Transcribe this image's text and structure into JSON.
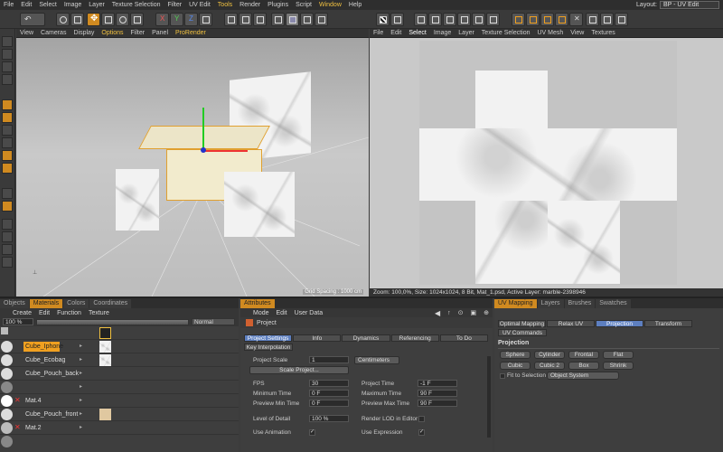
{
  "menubar": {
    "items": [
      "File",
      "Edit",
      "Select",
      "Image",
      "Layer",
      "Texture Selection",
      "Filter",
      "UV Edit",
      "Tools",
      "Render",
      "Plugins",
      "Script",
      "Window",
      "Help"
    ],
    "highlighted": [
      "Tools",
      "Window"
    ],
    "layout_label": "Layout:",
    "layout_value": "BP - UV Edit"
  },
  "viewport3d": {
    "menu": [
      "View",
      "Cameras",
      "Display",
      "Options",
      "Filter",
      "Panel",
      "ProRender"
    ],
    "highlighted": [
      "Options",
      "ProRender"
    ],
    "grid_spacing": "Grid Spacing : 1000 cm"
  },
  "uvview": {
    "menu": [
      "File",
      "Edit",
      "Select",
      "Image",
      "Layer",
      "Texture Selection",
      "UV Mesh",
      "View",
      "Textures"
    ],
    "highlighted": [
      "Select"
    ],
    "status": "Zoom: 100,0%, Size: 1024x1024, 8 Bit, Mat_1.psd, Active Layer: marble-2398946"
  },
  "materials": {
    "tabs": [
      "Objects",
      "Materials",
      "Colors",
      "Coordinates"
    ],
    "active_tab": "Materials",
    "menu": [
      "Create",
      "Edit",
      "Function",
      "Texture"
    ],
    "zoom": "100 %",
    "blend": "Normal",
    "rows": [
      {
        "name": "",
        "selected": false
      },
      {
        "name": "Cube_Iphone",
        "selected": true
      },
      {
        "name": "Cube_Ecobag",
        "selected": false
      },
      {
        "name": "Cube_Pouch_back",
        "selected": false
      },
      {
        "name": "",
        "selected": false
      },
      {
        "name": "Mat.4",
        "selected": false
      },
      {
        "name": "Cube_Pouch_front",
        "selected": false
      },
      {
        "name": "Mat.2",
        "selected": false
      }
    ]
  },
  "attributes": {
    "tab": "Attributes",
    "menu": [
      "Mode",
      "Edit",
      "User Data"
    ],
    "title": "Project",
    "tabs": [
      "Project Settings",
      "Info",
      "Dynamics",
      "Referencing",
      "To Do"
    ],
    "active_tab": "Project Settings",
    "subtab": "Key Interpolation",
    "project_scale_label": "Project Scale",
    "project_scale_value": "1",
    "project_scale_unit": "Centimeters",
    "scale_project_btn": "Scale Project...",
    "fps_label": "FPS",
    "fps_value": "30",
    "project_time_label": "Project Time",
    "project_time_value": "-1 F",
    "min_time_label": "Minimum Time",
    "min_time_value": "0 F",
    "max_time_label": "Maximum Time",
    "max_time_value": "90 F",
    "preview_min_label": "Preview Min Time",
    "preview_min_value": "0 F",
    "preview_max_label": "Preview Max Time",
    "preview_max_value": "90 F",
    "lod_label": "Level of Detail",
    "lod_value": "100 %",
    "render_lod_label": "Render LOD in Editor",
    "use_anim_label": "Use Animation",
    "use_expr_label": "Use Expression"
  },
  "uvpanel": {
    "tabs": [
      "UV Mapping",
      "Layers",
      "Brushes",
      "Swatches"
    ],
    "active_tab": "UV Mapping",
    "subtabs": [
      "Optimal Mapping",
      "Relax UV",
      "Projection",
      "Transform"
    ],
    "active_subtab": "Projection",
    "subtab2": "UV Commands",
    "section": "Projection",
    "buttons_row1": [
      "Sphere",
      "Cylinder",
      "Frontal",
      "Flat"
    ],
    "buttons_row2": [
      "Cubic",
      "Cubic 2",
      "Box",
      "Shrink"
    ],
    "fit_label": "Fit to Selection",
    "fit_value": "Object System"
  },
  "colors": {
    "accent": "#d08a20",
    "selection": "#5d7fc0",
    "highlight_text": "#f0c040"
  }
}
